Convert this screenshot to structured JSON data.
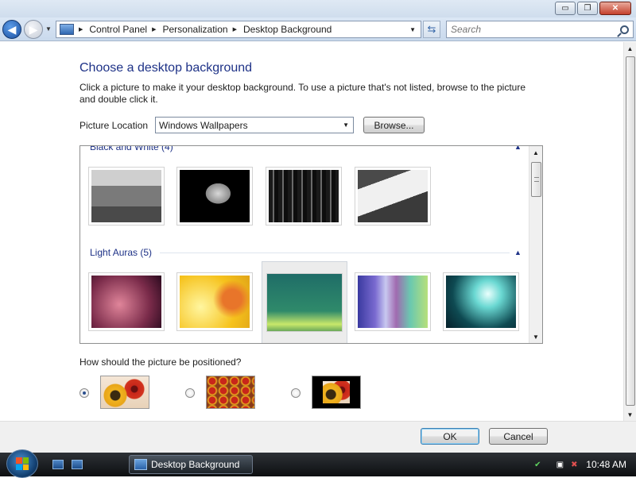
{
  "window": {
    "controls": {
      "minimize": "▭",
      "maximize": "❐",
      "close": "✕"
    }
  },
  "navigation": {
    "back_glyph": "◀",
    "forward_glyph": "▶",
    "breadcrumbs": [
      "Control Panel",
      "Personalization",
      "Desktop Background"
    ],
    "search_placeholder": "Search"
  },
  "page": {
    "title": "Choose a desktop background",
    "description": "Click a picture to make it your desktop background. To use a picture that's not listed, browse to the picture and double click it.",
    "picture_location_label": "Picture Location",
    "picture_location_value": "Windows Wallpapers",
    "browse_label": "Browse...",
    "groups": [
      {
        "name": "Black and White (4)",
        "images": [
          {
            "name": "train-interior",
            "colors": [
              "#9a9a9a",
              "#5a5a5a"
            ]
          },
          {
            "name": "leaf",
            "colors": [
              "#000000",
              "#bdbdbd"
            ]
          },
          {
            "name": "city-night",
            "colors": [
              "#0d0d0d",
              "#6a6a6a"
            ]
          },
          {
            "name": "tree-rocks",
            "colors": [
              "#e8e8e8",
              "#3a3a3a"
            ]
          }
        ]
      },
      {
        "name": "Light Auras (5)",
        "images": [
          {
            "name": "aura-pink",
            "colors": [
              "#3a0f2a",
              "#c8607a"
            ]
          },
          {
            "name": "aura-yellow",
            "colors": [
              "#f6c21c",
              "#e8752a"
            ]
          },
          {
            "name": "aura-green",
            "colors": [
              "#0e6a5c",
              "#c8e86a"
            ]
          },
          {
            "name": "aura-stripes",
            "colors": [
              "#3a3aa0",
              "#b7e07a"
            ]
          },
          {
            "name": "aura-teal",
            "colors": [
              "#0b2c36",
              "#bff6f2"
            ]
          }
        ]
      }
    ],
    "position_question": "How should the picture be positioned?",
    "position_options": [
      {
        "name": "fit",
        "checked": true
      },
      {
        "name": "tile",
        "checked": false
      },
      {
        "name": "center",
        "checked": false
      }
    ],
    "ok_label": "OK",
    "cancel_label": "Cancel"
  },
  "taskbar": {
    "task_label": "Desktop Background",
    "clock": "10:48 AM"
  }
}
